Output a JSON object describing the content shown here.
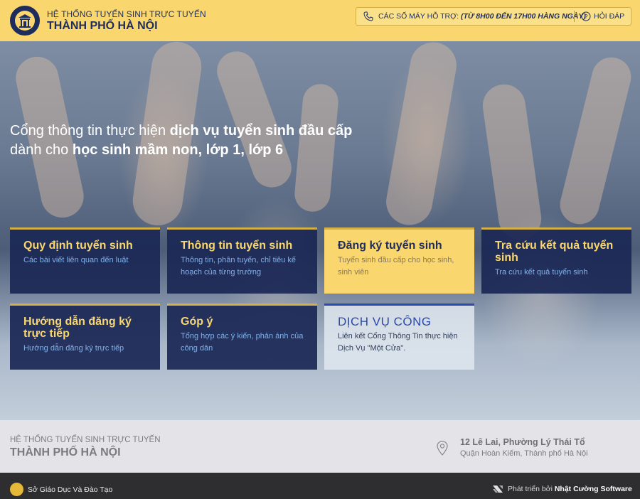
{
  "header": {
    "brand_top": "HỆ THỐNG TUYỂN SINH TRỰC TUYẾN",
    "brand_main": "THÀNH PHỐ HÀ NỘI",
    "support_label": "CÁC SỐ MÁY HỖ TRỢ:",
    "support_hours": "(TỪ 8H00 ĐẾN 17H00 HÀNG NGÀY)",
    "faq_label": "HỎI ĐÁP",
    "icons": [
      "logo-icon",
      "phone-icon",
      "help-circle-icon"
    ]
  },
  "hero": {
    "line1_plain": "Cổng thông tin thực hiện ",
    "line1_bold": "dịch vụ tuyển sinh đầu cấp",
    "line2_plain": "dành cho ",
    "line2_bold": "học sinh mầm non, lớp 1, lớp 6"
  },
  "tiles": [
    {
      "title": "Quy định tuyển sinh",
      "desc": "Các bài viết liên quan đến luật"
    },
    {
      "title": "Thông tin tuyển sinh",
      "desc": "Thông tin, phân tuyến, chỉ tiêu kế hoạch của từng trường"
    },
    {
      "title": "Đăng ký tuyển sinh",
      "desc": "Tuyển sinh đầu cấp cho học sinh, sinh viên"
    },
    {
      "title": "Tra cứu kết quả tuyển sinh",
      "desc": "Tra cứu kết quả tuyển sinh"
    },
    {
      "title": "Hướng dẫn đăng ký trực tiếp",
      "desc": "Hướng dẫn đăng ký trực tiếp"
    },
    {
      "title": "Góp ý",
      "desc": "Tổng hợp các ý kiến, phản ánh của công dân"
    },
    {
      "title": "DỊCH VỤ CÔNG",
      "desc": "Liên kết Cổng Thông Tin thực hiện Dịch Vụ \"Một Cửa\"."
    }
  ],
  "footer": {
    "brand_top": "HỆ THỐNG TUYỂN SINH TRỰC TUYẾN",
    "brand_main": "THÀNH PHỐ HÀ NỘI",
    "address_line1": "12 Lê Lai, Phường Lý Thái Tổ",
    "address_line2": "Quận Hoàn Kiếm, Thành phố Hà Nội"
  },
  "bottom": {
    "left_label": "Sở Giáo Dục Và Đào Tạo",
    "developed_by": "Phát triển bởi ",
    "developer": "Nhật Cường Software"
  },
  "colors": {
    "accent": "#f9d66e",
    "navy": "#1f2d5c",
    "tile_desc": "#7fb1ea"
  }
}
